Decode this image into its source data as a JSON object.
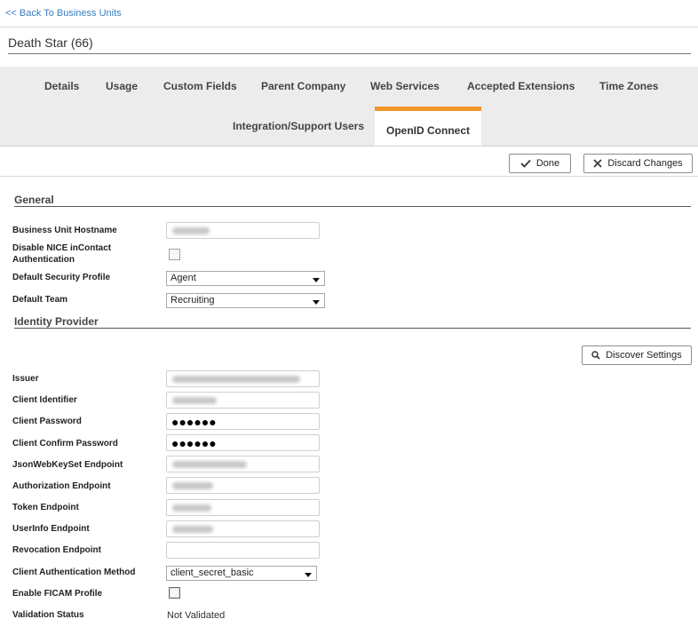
{
  "nav": {
    "back_label": "<< Back To Business Units"
  },
  "business_unit": {
    "title": "Death Star (66)"
  },
  "tabs": [
    {
      "label": "Details"
    },
    {
      "label": "Usage"
    },
    {
      "label": "Custom Fields"
    },
    {
      "label": "Parent Company"
    },
    {
      "label": "Web Services"
    },
    {
      "label": "Accepted Extensions"
    },
    {
      "label": "Time Zones"
    },
    {
      "label": "Integration/Support Users"
    },
    {
      "label": "OpenID Connect",
      "active": true
    }
  ],
  "toolbar": {
    "done_label": "Done",
    "discard_label": "Discard Changes"
  },
  "general": {
    "title": "General",
    "hostname_label": "Business Unit Hostname",
    "disable_auth_label_1": "Disable NICE inContact",
    "disable_auth_label_2": "Authentication",
    "disable_auth_checked": false,
    "security_profile_label": "Default Security Profile",
    "security_profile_value": "Agent",
    "team_label": "Default Team",
    "team_value": "Recruiting"
  },
  "identity_provider": {
    "title": "Identity Provider",
    "discover_label": "Discover Settings",
    "issuer_label": "Issuer",
    "client_id_label": "Client Identifier",
    "client_password_label": "Client Password",
    "client_password_value": "●●●●●●",
    "client_confirm_label": "Client Confirm Password",
    "client_confirm_value": "●●●●●●",
    "jwks_label": "JsonWebKeySet Endpoint",
    "auth_endpoint_label": "Authorization Endpoint",
    "token_endpoint_label": "Token Endpoint",
    "userinfo_label": "UserInfo Endpoint",
    "revocation_label": "Revocation Endpoint",
    "client_auth_method_label": "Client Authentication Method",
    "client_auth_method_value": "client_secret_basic",
    "ficam_label": "Enable FICAM Profile",
    "ficam_checked": false,
    "validation_label": "Validation Status",
    "validation_value": "Not Validated"
  },
  "icons": {
    "done": "checkmark-icon",
    "discard": "close-icon",
    "discover": "search-icon"
  },
  "colors": {
    "accent_tab": "#f0962a",
    "link": "#3a7fc2",
    "tab_bar_bg": "#ececec"
  }
}
